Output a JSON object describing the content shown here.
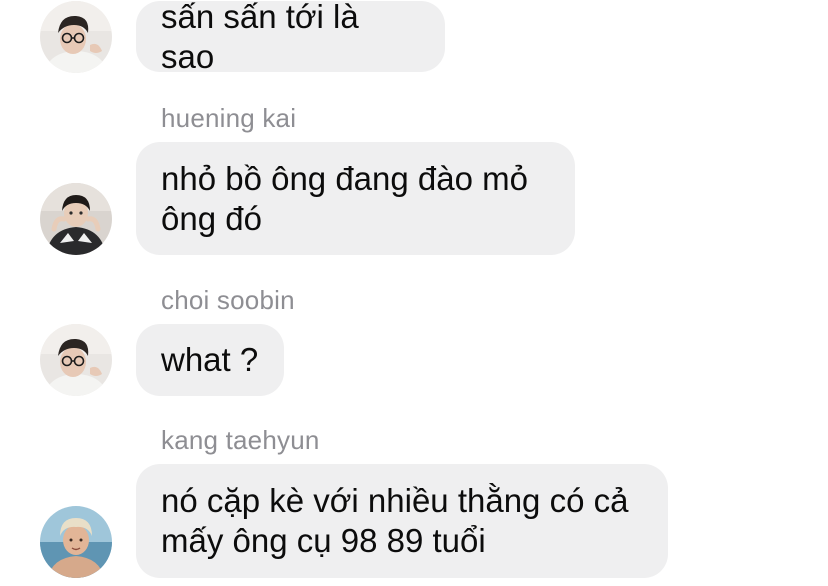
{
  "messages": [
    {
      "sender": "",
      "text": "sấn sấn tới là sao",
      "avatar_icon": "user-avatar-glasses"
    },
    {
      "sender": "huening kai",
      "text": "nhỏ bồ ông đang đào mỏ\nông đó",
      "avatar_icon": "user-avatar-jacket"
    },
    {
      "sender": "choi soobin",
      "text": "what ?",
      "avatar_icon": "user-avatar-glasses"
    },
    {
      "sender": "kang taehyun",
      "text": "nó cặp kè với nhiều thằng có cả\nmấy ông cụ 98 89 tuổi",
      "avatar_icon": "user-avatar-beach"
    }
  ],
  "colors": {
    "bubble_bg": "#efeff0",
    "sender_text": "#8e8e93",
    "message_text": "#0c0c0c"
  }
}
